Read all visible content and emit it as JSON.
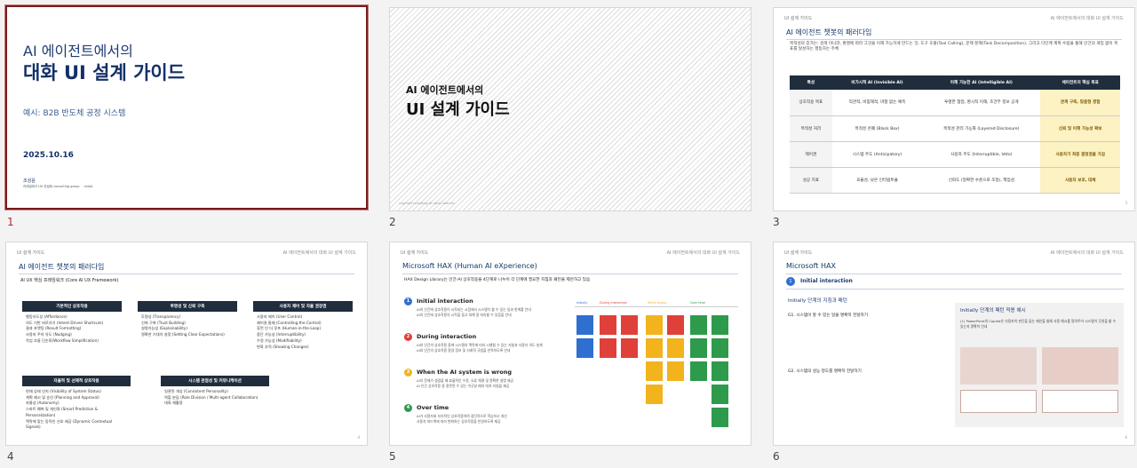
{
  "slides": [
    {
      "number": "1",
      "selected": true,
      "title_line1": "AI 에이전트에서의",
      "title_line2": "대화 UI 설계 가이드",
      "subtitle": "예시: B2B 반도체 공정 시스템",
      "date": "2025.10.16",
      "author": "조성윤",
      "org": "리테일테크 UX 컨설팅 consulting group ㆍ Udo&"
    },
    {
      "number": "2",
      "title_line1": "AI 에이전트에서의",
      "title_line2": "UI 설계 가이드",
      "footer": "copyright consulting all rights reserved"
    },
    {
      "number": "3",
      "header_left": "UI 설계 가이드",
      "header_right": "AI 에이전트에서의 대화 UI 설계 가이드",
      "title": "AI 에이전트 챗봇의 패러다임",
      "intro": "목적성의 증가는: 검색 아니라, 환경에 따라 그것을 이해 가능하게 만드는 것, 도구 호출(Tool Calling), 문제 분해(Task Decomposition), 그리고 다단계 계획 수립을 통해 인간의 개입 없이 목표를 달성하는 행동하는 주체",
      "columns": [
        "특성",
        "비가시적 AI (Invisible AI)",
        "이해 가능한 AI (Intelligible AI)",
        "에이전트의 핵심 목표"
      ],
      "rows": [
        [
          "상호작용 목표",
          "직관적, 비침해적, 마찰 없는 예측",
          "투명한 협업, 명시적 이해, 조건부 정보 공개",
          "관계 구축, 맞춤형 경험"
        ],
        [
          "목적성 처리",
          "목적성 은폐 (Black Box)",
          "목적성 관리 가능화 (Layered Disclosure)",
          "신뢰 및 이해 가능성 확보"
        ],
        [
          "제어권",
          "시스템 주도 (Anticipatory)",
          "사용자 주도 (Interruptible, Veto)",
          "사용자가 최종 결정권을 가짐"
        ],
        [
          "성공 지표",
          "효율성, 낮은 인터럽트율",
          "신뢰도 (정확한 수준으로 조정), 책임성",
          "사용자 보호, 대체"
        ]
      ],
      "page": "3"
    },
    {
      "number": "4",
      "header_left": "UI 설계 가이드",
      "header_right": "AI 에이전트에서의 대화 UI 설계 가이드",
      "title": "AI 에이전트 챗봇의 패러다임",
      "subtitle": "AI UX 핵심 프레임워크 (Core AI UX Framework)",
      "boxes": [
        {
          "title": "기본적인 상호작용",
          "items": [
            "행동유도성 (Affordance)",
            "의도 기반 바로가기 (Intent-Driven Shortcuts)",
            "결과 포맷팅 (Result Formatting)",
            "사용자 주의 유도 (Nudging)",
            "작업 흐름 단순화(Workflow Simplification)"
          ]
        },
        {
          "title": "투명성 및 신뢰 구축",
          "items": [
            "투명성 (Transparency)",
            "신뢰 구축 (Trust Building)",
            "설명가능성 (Explainability)",
            "명확한 기대치 설정 (Setting Clear Expectations)"
          ]
        },
        {
          "title": "사용자 제어 및 자율 권장권",
          "items": [
            "사용자 제어 (User Control)",
            "제어권 통제 (Controlling the Control)",
            "휴먼 인 더 루프 (Human-in-the-Loop)",
            "중단 가능성 (Interruptibility)",
            "수정 가능성 (Modifiability)",
            "변화 추적 (Showing Changes)"
          ]
        },
        {
          "title": "자율적 및 선제적 상호작용",
          "items": [
            "현재 상태 인지 (Visibility of System Status)",
            "계획 제시 및 승인 (Planning and Approval)",
            "자율성 (Autonomy)",
            "스마트 예측 및 개인화 (Smart Prediction & Personalization)",
            "맥락에 맞는 동적인 신호 제공 (Dynamic Contextual Signals)"
          ]
        },
        {
          "title": "시스템 관점성 및 커뮤니케이션",
          "items": [
            "일관된 개성 (Consistent Personality)",
            "역할 분담 (Role Division / Multi-agent Collaboration)",
            "대화 재활용"
          ]
        }
      ],
      "page": "4"
    },
    {
      "number": "5",
      "header_left": "UI 설계 가이드",
      "header_right": "AI 에이전트에서의 대화 UI 설계 가이드",
      "title": "Microsoft HAX (Human AI eXperience)",
      "subtitle": "HAX Design Library는 인간-AI 상호작용을 4단계로 나누어 각 단계에 필요한 지침과 패턴을 제안하고 있음",
      "stages": [
        {
          "n": "1",
          "title": "Initial interaction",
          "lines": [
            "AI의 인간에 상호작용이 시작되는 시점에서 시스템이 할 수 있는 일과 한계를 안내",
            "AI의 인간에 상호작용의 시작을 돕고 대해 잘 처리할 수 있음을 안내"
          ]
        },
        {
          "n": "2",
          "title": "During interaction",
          "lines": [
            "AI와 인간의 상호작용 중에 시스템의 맥락에 따라 시행될 수 있는 지침과 사용자 의도 설계",
            "AI와 인간의 상호작용 환경 정보 및 사회적 규범을 만족하도록 안내"
          ]
        },
        {
          "n": "3",
          "title": "When the AI system is wrong",
          "lines": [
            "AI의 문제가 생겼을 때 효율적인 수정, 오류 해결 및 명확한 설명 제공",
            "AI 인간 상호작용 중 잘못된 수 있는 어긋날 때의 대처 지침을 제공"
          ]
        },
        {
          "n": "4",
          "title": "Over time",
          "lines": [
            "AI가 사용자와 지속적인 상호작용하며 점진적으로 학습하고 개선",
            "사용자 피드백에 따라 변화하는 상호작용을 반영하도록 제공"
          ]
        }
      ],
      "collab_labels": [
        "Initially",
        "During interaction",
        "When wrong",
        "Over time"
      ],
      "stage_colors": [
        "#2f6fd0",
        "#e0403a",
        "#f2b31c",
        "#2e9a4c"
      ]
    },
    {
      "number": "6",
      "header_left": "UI 설계 가이드",
      "header_right": "AI 에이전트에서의 대화 UI 설계 가이드",
      "title": "Microsoft HAX",
      "badge": "1",
      "badge_label": "Initial interaction",
      "left_heading": "Initially 단계의 지침과 패턴",
      "g1": "G1. 시스템이 할 수 있는 일을 명확히 전달하기",
      "g2": "G2. 시스템의 성능 정도를 명확히 전달하기",
      "right_heading": "Initially 단계의 패턴 적용 예시",
      "right_desc": "(1) PowerPoint의 Copilot은 사용자의 판단을 돕는 제안을 통해 사용 예시를 알려주어 시스템이 무엇을 할 수 있는지 명확히 안내",
      "page": "6"
    }
  ]
}
